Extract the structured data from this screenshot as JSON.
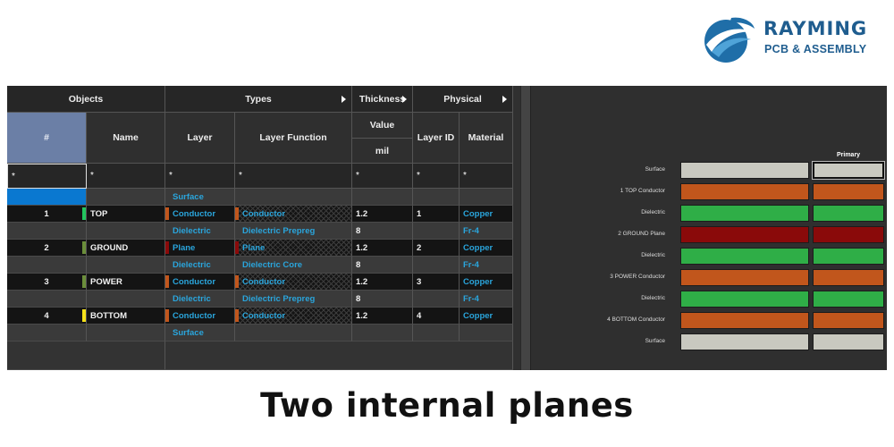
{
  "logo": {
    "name": "RAYMING",
    "subtitle": "PCB & ASSEMBLY",
    "color": "#1f5d8f"
  },
  "caption": "Two internal planes",
  "grid": {
    "group_headers": {
      "objects": "Objects",
      "types": "Types",
      "thickness": "Thickness",
      "physical": "Physical"
    },
    "columns": {
      "hash": "#",
      "name": "Name",
      "layer": "Layer",
      "layer_function": "Layer Function",
      "value": "Value",
      "unit": "mil",
      "layer_id": "Layer ID",
      "material": "Material"
    },
    "filter": "*",
    "rows": [
      {
        "num": "",
        "name": "",
        "layer": "Surface",
        "function": "",
        "value": "",
        "id": "",
        "material": "",
        "swatch": "",
        "type": "surface"
      },
      {
        "num": "1",
        "name": "TOP",
        "layer": "Conductor",
        "function": "Conductor",
        "value": "1.2",
        "id": "1",
        "material": "Copper",
        "swatch": "#22c55e",
        "type": "conductor"
      },
      {
        "num": "",
        "name": "",
        "layer": "Dielectric",
        "function": "Dielectric Prepreg",
        "value": "8",
        "id": "",
        "material": "Fr-4",
        "swatch": "",
        "type": "dielectric"
      },
      {
        "num": "2",
        "name": "GROUND",
        "layer": "Plane",
        "function": "Plane",
        "value": "1.2",
        "id": "2",
        "material": "Copper",
        "swatch": "#6b8e3a",
        "type": "plane"
      },
      {
        "num": "",
        "name": "",
        "layer": "Dielectric",
        "function": "Dielectric Core",
        "value": "8",
        "id": "",
        "material": "Fr-4",
        "swatch": "",
        "type": "dielectric"
      },
      {
        "num": "3",
        "name": "POWER",
        "layer": "Conductor",
        "function": "Conductor",
        "value": "1.2",
        "id": "3",
        "material": "Copper",
        "swatch": "#6b8e3a",
        "type": "conductor"
      },
      {
        "num": "",
        "name": "",
        "layer": "Dielectric",
        "function": "Dielectric Prepreg",
        "value": "8",
        "id": "",
        "material": "Fr-4",
        "swatch": "",
        "type": "dielectric"
      },
      {
        "num": "4",
        "name": "BOTTOM",
        "layer": "Conductor",
        "function": "Conductor",
        "value": "1.2",
        "id": "4",
        "material": "Copper",
        "swatch": "#f5e11a",
        "type": "conductor"
      },
      {
        "num": "",
        "name": "",
        "layer": "Surface",
        "function": "",
        "value": "",
        "id": "",
        "material": "",
        "swatch": "",
        "type": "surface"
      }
    ]
  },
  "stack": {
    "primary_label": "Primary",
    "layers": [
      {
        "label": "Surface",
        "color": "#c9c9c0"
      },
      {
        "label": "1    TOP Conductor",
        "color": "#c1561c"
      },
      {
        "label": "Dielectric",
        "color": "#2fae47"
      },
      {
        "label": "2    GROUND Plane",
        "color": "#8a0a0a"
      },
      {
        "label": "Dielectric",
        "color": "#2fae47"
      },
      {
        "label": "3    POWER Conductor",
        "color": "#c1561c"
      },
      {
        "label": "Dielectric",
        "color": "#2fae47"
      },
      {
        "label": "4    BOTTOM Conductor",
        "color": "#c1561c"
      },
      {
        "label": "Surface",
        "color": "#c9c9c0"
      }
    ]
  },
  "colors": {
    "conductor_marker": "#c1561c",
    "plane_marker": "#8a0a0a",
    "text_cyan": "#2aa5dc"
  }
}
